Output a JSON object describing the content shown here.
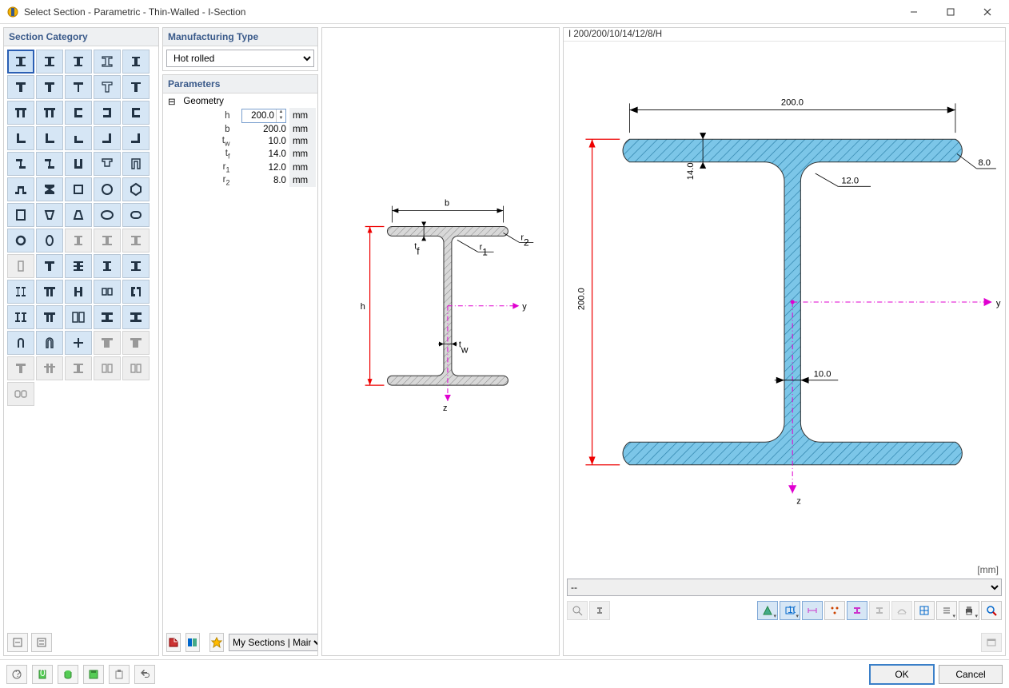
{
  "window": {
    "title": "Select Section - Parametric - Thin-Walled - I-Section"
  },
  "left_panel": {
    "title": "Section Category"
  },
  "mfg_panel": {
    "title": "Manufacturing Type",
    "selected": "Hot rolled"
  },
  "param_panel": {
    "title": "Parameters",
    "group": "Geometry",
    "rows": [
      {
        "name": "h",
        "value": "200.0",
        "unit": "mm",
        "editable": true
      },
      {
        "name": "b",
        "value": "200.0",
        "unit": "mm"
      },
      {
        "name": "tw",
        "value": "10.0",
        "unit": "mm"
      },
      {
        "name": "tf",
        "value": "14.0",
        "unit": "mm"
      },
      {
        "name": "r1",
        "value": "12.0",
        "unit": "mm"
      },
      {
        "name": "r2",
        "value": "8.0",
        "unit": "mm"
      }
    ]
  },
  "schematic": {
    "labels": {
      "h": "h",
      "b": "b",
      "tw": "tw",
      "tf": "tf",
      "r1": "r1",
      "r2": "r2",
      "y": "y",
      "z": "z"
    }
  },
  "preview": {
    "title": "I 200/200/10/14/12/8/H",
    "dims": {
      "b": "200.0",
      "h": "200.0",
      "tf": "14.0",
      "r1": "12.0",
      "r2": "8.0",
      "tw": "10.0"
    },
    "axes": {
      "y": "y",
      "z": "z"
    },
    "unit_label": "[mm]",
    "dropdown": "--"
  },
  "col2foot": {
    "library": "My Sections | Main"
  },
  "buttons": {
    "ok": "OK",
    "cancel": "Cancel"
  }
}
